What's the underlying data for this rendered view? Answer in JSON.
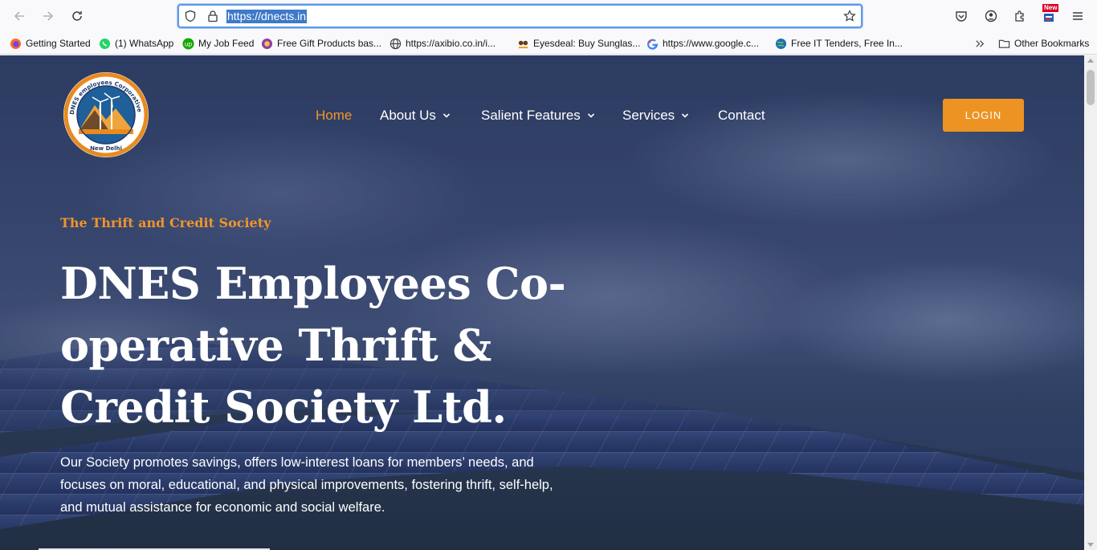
{
  "browser": {
    "url": "https://dnects.in",
    "badge": "New",
    "bookmarks": [
      {
        "label": "Getting Started",
        "icon": "firefox-icon"
      },
      {
        "label": "(1) WhatsApp",
        "icon": "whatsapp-icon"
      },
      {
        "label": "My Job Feed",
        "icon": "upwork-icon"
      },
      {
        "label": "Free Gift Products bas...",
        "icon": "gift-site-icon"
      },
      {
        "label": "https://axibio.co.in/i...",
        "icon": "globe-icon"
      },
      {
        "label": "Eyesdeal: Buy Sunglas...",
        "icon": "eyesdeal-icon"
      },
      {
        "label": "https://www.google.c...",
        "icon": "google-icon"
      },
      {
        "label": "Free IT Tenders, Free In...",
        "icon": "tenders-icon"
      }
    ],
    "other_bookmarks": "Other Bookmarks"
  },
  "site": {
    "logo_text": {
      "ring": "DNES employees Corporative Thrift & Credit Society",
      "city": "New Delhi"
    },
    "nav": [
      {
        "label": "Home",
        "active": true,
        "dropdown": false
      },
      {
        "label": "About Us",
        "active": false,
        "dropdown": true
      },
      {
        "label": "Salient Features",
        "active": false,
        "dropdown": true
      },
      {
        "label": "Services",
        "active": false,
        "dropdown": true
      },
      {
        "label": "Contact",
        "active": false,
        "dropdown": false
      }
    ],
    "login_label": "LOGIN"
  },
  "hero": {
    "eyebrow": "The Thrift and Credit Society",
    "title_lines": [
      "DNES Employees Co-",
      "operative Thrift &",
      "Credit Society Ltd."
    ],
    "description_lines": [
      "Our Society promotes savings, offers low-interest loans for members’ needs, and",
      "focuses on moral, educational, and physical improvements, fostering thrift, self-help,",
      "and mutual assistance for economic and social welfare."
    ]
  },
  "colors": {
    "accent": "#ec9323",
    "overlay": "#2f3e63",
    "text": "#ffffff"
  }
}
